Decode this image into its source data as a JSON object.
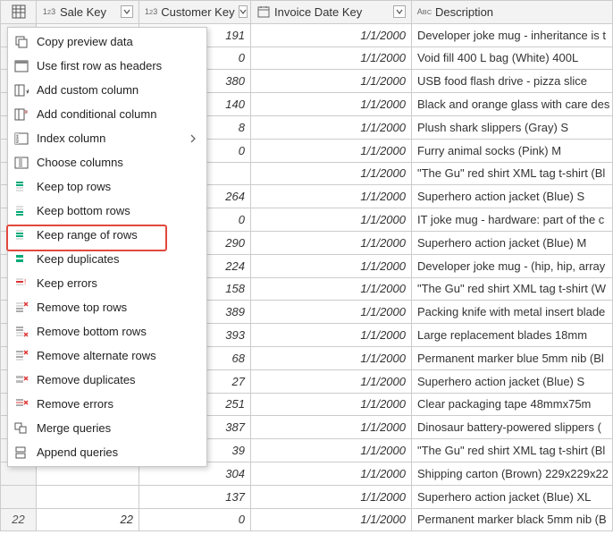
{
  "columns": {
    "sale_key": "Sale Key",
    "customer_key": "Customer Key",
    "invoice_date_key": "Invoice Date Key",
    "description": "Description"
  },
  "menu": {
    "copy_preview_data": "Copy preview data",
    "use_first_row": "Use first row as headers",
    "add_custom_column": "Add custom column",
    "add_conditional_column": "Add conditional column",
    "index_column": "Index column",
    "choose_columns": "Choose columns",
    "keep_top_rows": "Keep top rows",
    "keep_bottom_rows": "Keep bottom rows",
    "keep_range_of_rows": "Keep range of rows",
    "keep_duplicates": "Keep duplicates",
    "keep_errors": "Keep errors",
    "remove_top_rows": "Remove top rows",
    "remove_bottom_rows": "Remove bottom rows",
    "remove_alternate_rows": "Remove alternate rows",
    "remove_duplicates": "Remove duplicates",
    "remove_errors": "Remove errors",
    "merge_queries": "Merge queries",
    "append_queries": "Append queries"
  },
  "rows": [
    {
      "rn": "",
      "sale": "",
      "cust": "191",
      "date": "1/1/2000",
      "desc": "Developer joke mug - inheritance is t"
    },
    {
      "rn": "",
      "sale": "",
      "cust": "0",
      "date": "1/1/2000",
      "desc": "Void fill 400 L bag (White) 400L"
    },
    {
      "rn": "",
      "sale": "",
      "cust": "380",
      "date": "1/1/2000",
      "desc": "USB food flash drive - pizza slice"
    },
    {
      "rn": "",
      "sale": "",
      "cust": "140",
      "date": "1/1/2000",
      "desc": "Black and orange glass with care des"
    },
    {
      "rn": "",
      "sale": "",
      "cust": "8",
      "date": "1/1/2000",
      "desc": "Plush shark slippers (Gray) S"
    },
    {
      "rn": "",
      "sale": "",
      "cust": "0",
      "date": "1/1/2000",
      "desc": "Furry animal socks (Pink) M"
    },
    {
      "rn": "",
      "sale": "",
      "cust": "",
      "date": "1/1/2000",
      "desc": "\"The Gu\" red shirt XML tag t-shirt (Bl"
    },
    {
      "rn": "",
      "sale": "",
      "cust": "264",
      "date": "1/1/2000",
      "desc": "Superhero action jacket (Blue) S"
    },
    {
      "rn": "",
      "sale": "",
      "cust": "0",
      "date": "1/1/2000",
      "desc": "IT joke mug - hardware: part of the c"
    },
    {
      "rn": "",
      "sale": "",
      "cust": "290",
      "date": "1/1/2000",
      "desc": "Superhero action jacket (Blue) M"
    },
    {
      "rn": "",
      "sale": "",
      "cust": "224",
      "date": "1/1/2000",
      "desc": "Developer joke mug - (hip, hip, array"
    },
    {
      "rn": "",
      "sale": "",
      "cust": "158",
      "date": "1/1/2000",
      "desc": "\"The Gu\" red shirt XML tag t-shirt (W"
    },
    {
      "rn": "",
      "sale": "",
      "cust": "389",
      "date": "1/1/2000",
      "desc": "Packing knife with metal insert blade"
    },
    {
      "rn": "",
      "sale": "",
      "cust": "393",
      "date": "1/1/2000",
      "desc": "Large replacement blades 18mm"
    },
    {
      "rn": "",
      "sale": "",
      "cust": "68",
      "date": "1/1/2000",
      "desc": "Permanent marker blue 5mm nib (Bl"
    },
    {
      "rn": "",
      "sale": "",
      "cust": "27",
      "date": "1/1/2000",
      "desc": "Superhero action jacket (Blue) S"
    },
    {
      "rn": "",
      "sale": "",
      "cust": "251",
      "date": "1/1/2000",
      "desc": "Clear packaging tape 48mmx75m"
    },
    {
      "rn": "",
      "sale": "",
      "cust": "387",
      "date": "1/1/2000",
      "desc": "Dinosaur battery-powered slippers ("
    },
    {
      "rn": "",
      "sale": "",
      "cust": "39",
      "date": "1/1/2000",
      "desc": "\"The Gu\" red shirt XML tag t-shirt (Bl"
    },
    {
      "rn": "",
      "sale": "",
      "cust": "304",
      "date": "1/1/2000",
      "desc": "Shipping carton (Brown) 229x229x22"
    },
    {
      "rn": "",
      "sale": "",
      "cust": "137",
      "date": "1/1/2000",
      "desc": "Superhero action jacket (Blue) XL"
    },
    {
      "rn": "22",
      "sale": "22",
      "cust": "0",
      "date": "1/1/2000",
      "desc": "Permanent marker black 5mm nib (B"
    }
  ]
}
